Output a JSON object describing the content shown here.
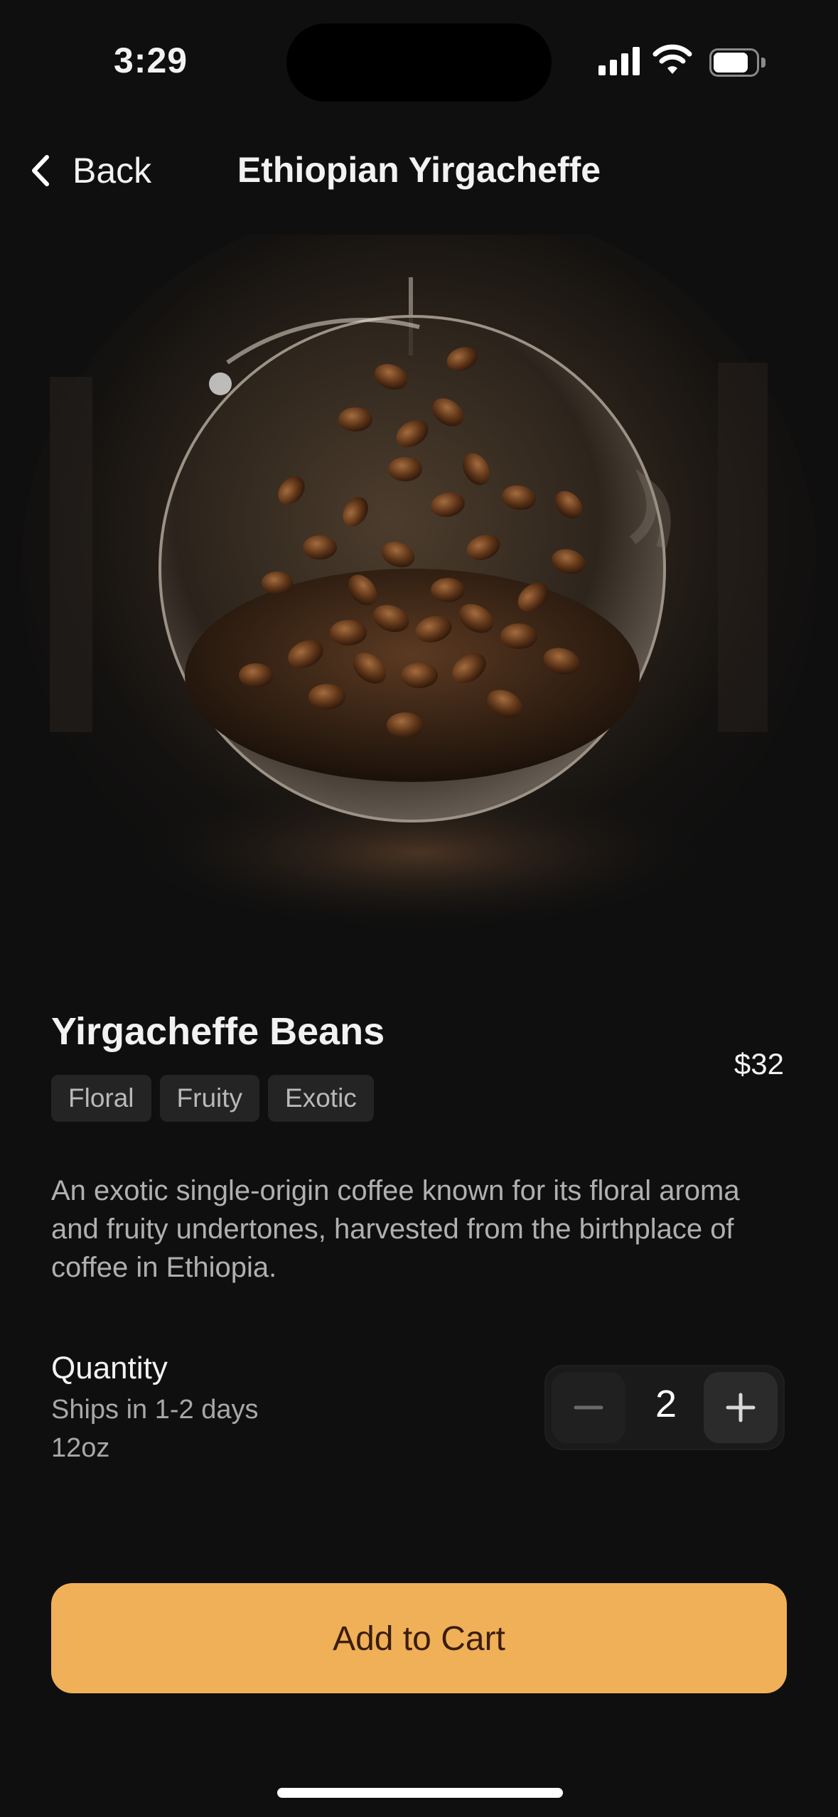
{
  "status_bar": {
    "time": "3:29"
  },
  "nav": {
    "back_label": "Back",
    "title": "Ethiopian Yirgacheffe"
  },
  "product": {
    "name": "Yirgacheffe Beans",
    "price": "$32",
    "tags": [
      "Floral",
      "Fruity",
      "Exotic"
    ],
    "description": "An exotic single-origin coffee known for its floral aroma and fruity undertones, harvested from the birthplace of coffee in Ethiopia."
  },
  "quantity": {
    "label": "Quantity",
    "shipping": "Ships in 1-2 days",
    "size": "12oz",
    "value": "2"
  },
  "cart_button": {
    "label": "Add to Cart"
  },
  "icons": {
    "back": "chevron-left-icon",
    "minus": "minus-icon",
    "plus": "plus-icon",
    "signal": "cellular-signal-icon",
    "wifi": "wifi-icon",
    "battery": "battery-icon"
  },
  "colors": {
    "background": "#0f0f0f",
    "accent": "#f0b058",
    "accent_text": "#3b1d0b",
    "tag_bg": "#242424"
  }
}
